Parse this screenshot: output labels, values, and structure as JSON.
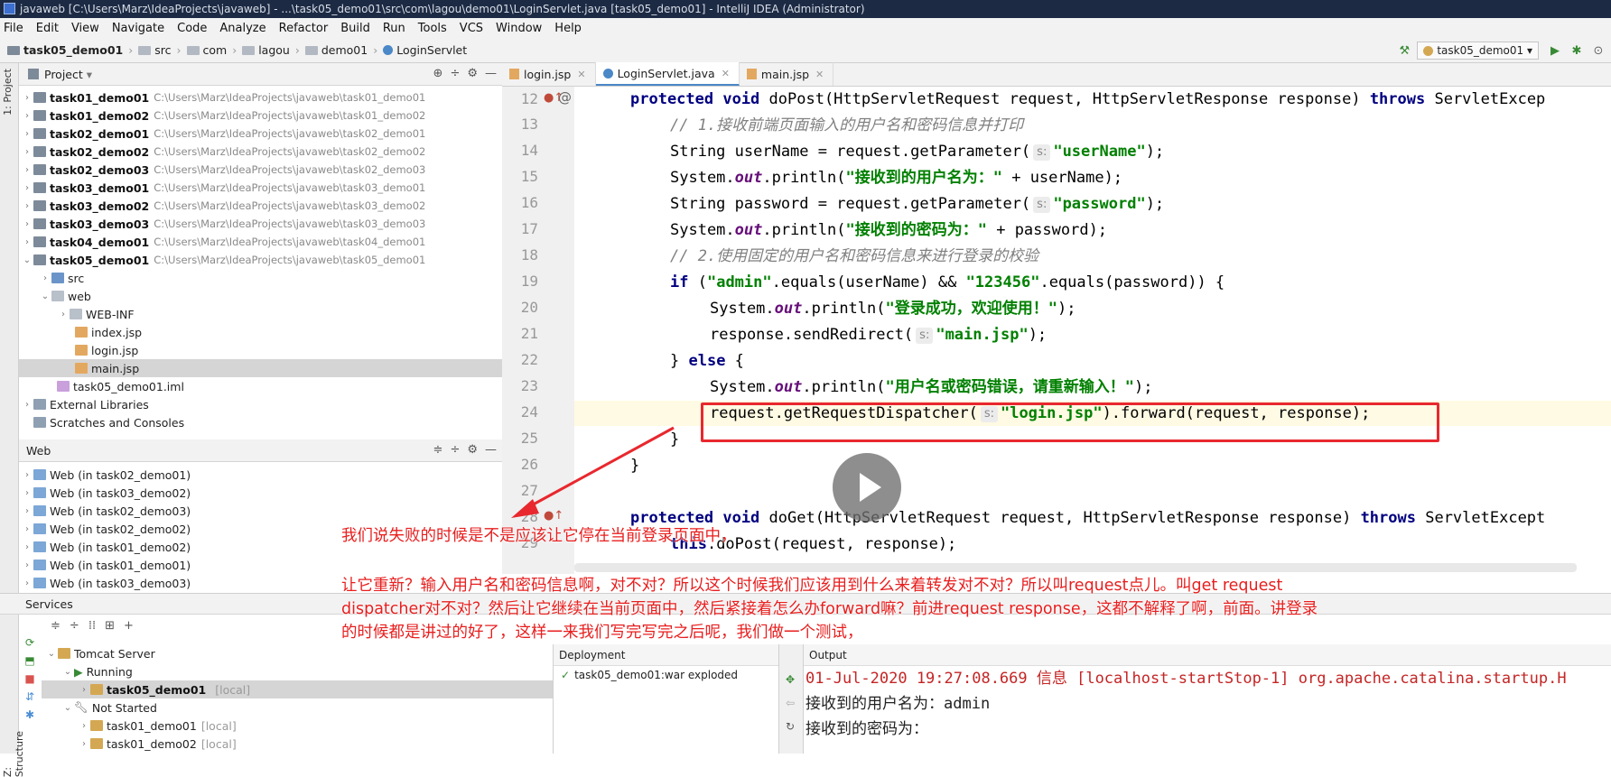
{
  "window": {
    "title": "javaweb [C:\\Users\\Marz\\IdeaProjects\\javaweb] - ...\\task05_demo01\\src\\com\\lagou\\demo01\\LoginServlet.java [task05_demo01] - IntelliJ IDEA (Administrator)"
  },
  "menu": [
    "File",
    "Edit",
    "View",
    "Navigate",
    "Code",
    "Analyze",
    "Refactor",
    "Build",
    "Run",
    "Tools",
    "VCS",
    "Window",
    "Help"
  ],
  "breadcrumb": [
    "task05_demo01",
    "src",
    "com",
    "lagou",
    "demo01",
    "LoginServlet"
  ],
  "run_config": "task05_demo01",
  "left_strip": {
    "project": "1: Project",
    "structure": "Z: Structure"
  },
  "project_panel": {
    "title": "Project",
    "items": [
      {
        "name": "task01_demo01",
        "path": "C:\\Users\\Marz\\IdeaProjects\\javaweb\\task01_demo01"
      },
      {
        "name": "task01_demo02",
        "path": "C:\\Users\\Marz\\IdeaProjects\\javaweb\\task01_demo02"
      },
      {
        "name": "task02_demo01",
        "path": "C:\\Users\\Marz\\IdeaProjects\\javaweb\\task02_demo01"
      },
      {
        "name": "task02_demo02",
        "path": "C:\\Users\\Marz\\IdeaProjects\\javaweb\\task02_demo02"
      },
      {
        "name": "task02_demo03",
        "path": "C:\\Users\\Marz\\IdeaProjects\\javaweb\\task02_demo03"
      },
      {
        "name": "task03_demo01",
        "path": "C:\\Users\\Marz\\IdeaProjects\\javaweb\\task03_demo01"
      },
      {
        "name": "task03_demo02",
        "path": "C:\\Users\\Marz\\IdeaProjects\\javaweb\\task03_demo02"
      },
      {
        "name": "task03_demo03",
        "path": "C:\\Users\\Marz\\IdeaProjects\\javaweb\\task03_demo03"
      },
      {
        "name": "task04_demo01",
        "path": "C:\\Users\\Marz\\IdeaProjects\\javaweb\\task04_demo01"
      },
      {
        "name": "task05_demo01",
        "path": "C:\\Users\\Marz\\IdeaProjects\\javaweb\\task05_demo01"
      }
    ],
    "sub": {
      "src": "src",
      "web": "web",
      "webinf": "WEB-INF",
      "index": "index.jsp",
      "login": "login.jsp",
      "main": "main.jsp",
      "iml": "task05_demo01.iml",
      "ext": "External Libraries",
      "scratch": "Scratches and Consoles"
    }
  },
  "web_panel": {
    "title": "Web",
    "items": [
      "Web (in task02_demo01)",
      "Web (in task03_demo02)",
      "Web (in task02_demo03)",
      "Web (in task02_demo02)",
      "Web (in task01_demo02)",
      "Web (in task01_demo01)",
      "Web (in task03_demo03)"
    ]
  },
  "tabs": [
    "login.jsp",
    "LoginServlet.java",
    "main.jsp"
  ],
  "editor": {
    "line_numbers": [
      "12",
      "13",
      "14",
      "15",
      "16",
      "17",
      "18",
      "19",
      "20",
      "21",
      "22",
      "23",
      "24",
      "25",
      "26",
      "27",
      "28",
      "29"
    ]
  },
  "code": {
    "l12a": "protected void ",
    "l12b": "doPost(HttpServletRequest request, HttpServletResponse response) ",
    "l12c": "throws ",
    "l12d": "ServletExcep",
    "l13": "// 1.接收前端页面输入的用户名和密码信息并打印",
    "l14a": "String userName = request.getParameter(",
    "l14h": "s:",
    "l14s": "\"userName\"",
    "l14e": ");",
    "l15a": "System.",
    "l15f": "out",
    "l15b": ".println(",
    "l15s": "\"接收到的用户名为：\"",
    "l15e": " + userName);",
    "l16a": "String password = request.getParameter(",
    "l16h": "s:",
    "l16s": "\"password\"",
    "l16e": ");",
    "l17a": "System.",
    "l17f": "out",
    "l17b": ".println(",
    "l17s": "\"接收到的密码为：\"",
    "l17e": " + password);",
    "l18": "// 2.使用固定的用户名和密码信息来进行登录的校验",
    "l19k": "if ",
    "l19a": "(",
    "l19s1": "\"admin\"",
    "l19b": ".equals(userName) && ",
    "l19s2": "\"123456\"",
    "l19c": ".equals(password)) {",
    "l20a": "System.",
    "l20f": "out",
    "l20b": ".println(",
    "l20s": "\"登录成功，欢迎使用！\"",
    "l20e": ");",
    "l21a": "response.sendRedirect(",
    "l21h": "s:",
    "l21s": "\"main.jsp\"",
    "l21e": ");",
    "l22a": "} ",
    "l22k": "else ",
    "l22b": "{",
    "l23a": "System.",
    "l23f": "out",
    "l23b": ".println(",
    "l23s": "\"用户名或密码错误，请重新输入！\"",
    "l23e": ");",
    "l24a": "request.getRequestDispatcher(",
    "l24h": "s:",
    "l24s": "\"login.jsp\"",
    "l24e": ").forward(request, response);",
    "l25": "}",
    "l26": "}",
    "l28a": "protected void ",
    "l28b": "doGet(HttpServletRequest request, HttpServletResponse response) ",
    "l28c": "throws ",
    "l28d": "ServletExcept",
    "l29k": "this",
    "l29a": ".doPost(request, response);"
  },
  "subtitles": [
    "我们说失败的时候是不是应该让它停在当前登录页面中，",
    "让它重新？输入用户名和密码信息啊，对不对？所以这个时候我们应该用到什么来着转发对不对？所以叫request点儿。叫get request",
    "dispatcher对不对？然后让它继续在当前页面中，然后紧接着怎么办forward嘛？前进request response，这都不解释了啊，前面。讲登录",
    "的时候都是讲过的好了，这样一来我们写完写完之后呢，我们做一个测试，"
  ],
  "services": {
    "title": "Services",
    "tomcat": "Tomcat Server",
    "running": "Running",
    "running_item": "task05_demo01",
    "running_loc": "[local]",
    "not_started": "Not Started",
    "ns1": "task01_demo01",
    "ns2": "task01_demo02",
    "loc": "[local]"
  },
  "deployment": {
    "title": "Deployment",
    "item": "task05_demo01:war exploded"
  },
  "output": {
    "title": "Output",
    "lines": [
      "01-Jul-2020 19:27:08.669 信息 [localhost-startStop-1] org.apache.catalina.startup.H",
      "接收到的用户名为：admin",
      "接收到的密码为："
    ]
  }
}
